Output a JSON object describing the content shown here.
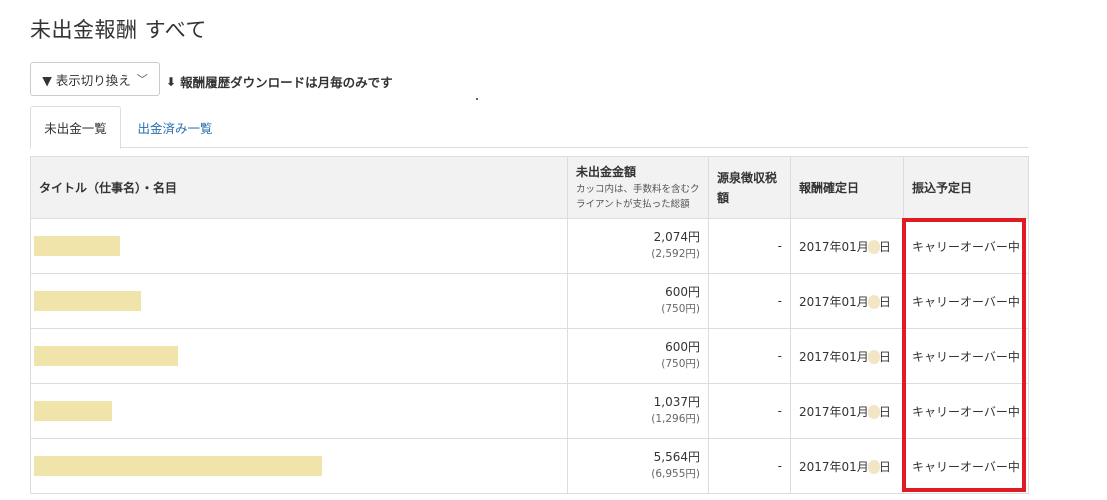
{
  "page": {
    "title": "未出金報酬 すべて"
  },
  "toolbar": {
    "view_toggle_label": "▼ 表示切り換え",
    "download_label": "報酬履歴ダウンロードは月毎のみです"
  },
  "tabs": [
    {
      "label": "未出金一覧",
      "active": true
    },
    {
      "label": "出金済み一覧",
      "active": false
    }
  ],
  "table": {
    "headers": {
      "title": "タイトル（仕事名）・名目",
      "amount": "未出金金額",
      "amount_note": "カッコ内は、手数料を含むクライアントが支払った総額",
      "tax": "源泉徴収税額",
      "confirm_date": "報酬確定日",
      "transfer_date": "振込予定日"
    },
    "rows": [
      {
        "amount": "2,074円",
        "amount_total": "(2,592円)",
        "tax": "-",
        "date_prefix": "2017年01月",
        "date_suffix": "日",
        "status": "キャリーオーバー中",
        "redacted_width": 0.3
      },
      {
        "amount": "600円",
        "amount_total": "(750円)",
        "tax": "-",
        "date_prefix": "2017年01月",
        "date_suffix": "日",
        "status": "キャリーオーバー中",
        "redacted_width": 0.37
      },
      {
        "amount": "600円",
        "amount_total": "(750円)",
        "tax": "-",
        "date_prefix": "2017年01月",
        "date_suffix": "日",
        "status": "キャリーオーバー中",
        "redacted_width": 0.5
      },
      {
        "amount": "1,037円",
        "amount_total": "(1,296円)",
        "tax": "-",
        "date_prefix": "2017年01月",
        "date_suffix": "日",
        "status": "キャリーオーバー中",
        "redacted_width": 0.27
      },
      {
        "amount": "5,564円",
        "amount_total": "(6,955円)",
        "tax": "-",
        "date_prefix": "2017年01月",
        "date_suffix": "日",
        "status": "キャリーオーバー中",
        "redacted_width": 1.0
      }
    ]
  },
  "colors": {
    "highlight": "#e01b24",
    "redacted": "#f0e4aa",
    "link": "#2a6fae"
  }
}
